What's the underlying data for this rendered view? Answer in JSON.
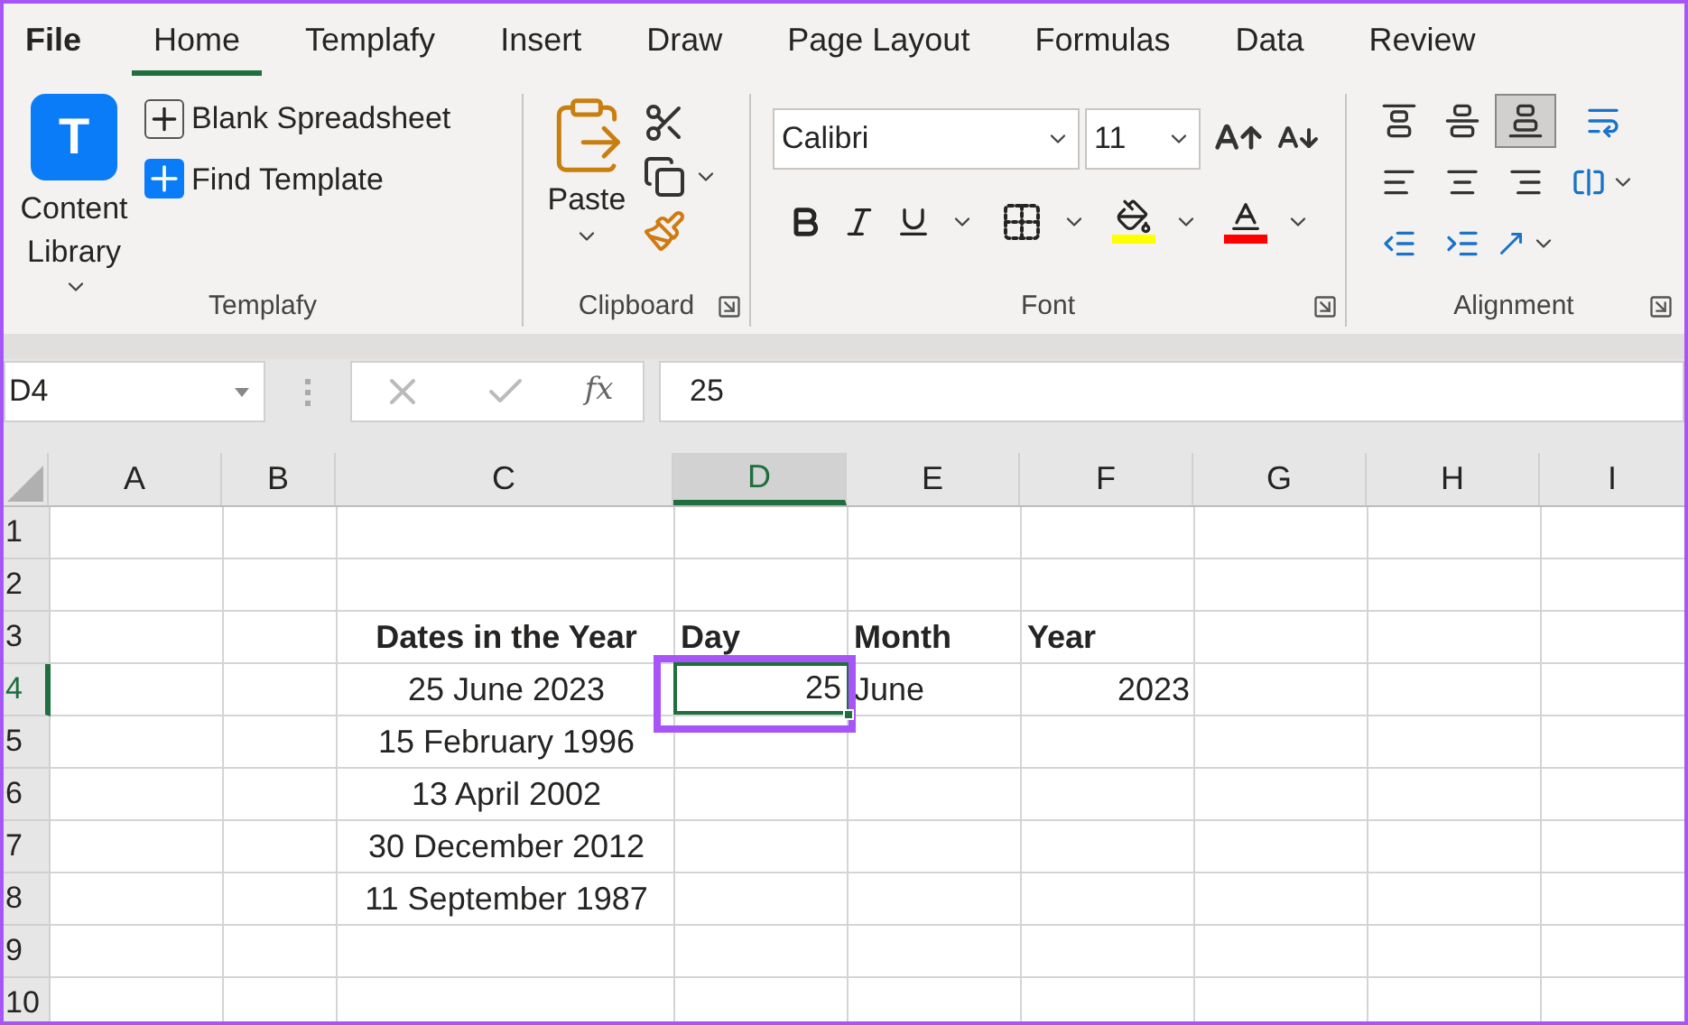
{
  "menu_tabs": [
    {
      "label": "File",
      "selected": false
    },
    {
      "label": "Home",
      "selected": true
    },
    {
      "label": "Templafy",
      "selected": false
    },
    {
      "label": "Insert",
      "selected": false
    },
    {
      "label": "Draw",
      "selected": false
    },
    {
      "label": "Page Layout",
      "selected": false
    },
    {
      "label": "Formulas",
      "selected": false
    },
    {
      "label": "Data",
      "selected": false
    },
    {
      "label": "Review",
      "selected": false
    }
  ],
  "templafy": {
    "logo_letter": "T",
    "content_library": "Content Library",
    "blank_spreadsheet": "Blank Spreadsheet",
    "find_template": "Find Template",
    "label": "Templafy"
  },
  "clipboard": {
    "paste": "Paste",
    "label": "Clipboard"
  },
  "font": {
    "name": "Calibri",
    "size": "11",
    "label": "Font"
  },
  "alignment": {
    "buttons": [
      {
        "kind": "top",
        "selected": false
      },
      {
        "kind": "middle",
        "selected": false
      },
      {
        "kind": "bottom",
        "selected": true
      },
      {
        "kind": "wrap",
        "selected": false
      },
      {
        "kind": "left",
        "selected": false
      },
      {
        "kind": "center",
        "selected": false
      },
      {
        "kind": "right",
        "selected": false
      },
      {
        "kind": "merge",
        "selected": false
      },
      {
        "kind": "outdent",
        "selected": false
      },
      {
        "kind": "indent",
        "selected": false
      },
      {
        "kind": "orientation",
        "selected": false
      }
    ],
    "label": "Alignment"
  },
  "formula_bar": {
    "name_box": "D4",
    "fx": "fx",
    "value": "25"
  },
  "columns": [
    {
      "label": "A",
      "selected": false
    },
    {
      "label": "B",
      "selected": false
    },
    {
      "label": "C",
      "selected": false
    },
    {
      "label": "D",
      "selected": true
    },
    {
      "label": "E",
      "selected": false
    },
    {
      "label": "F",
      "selected": false
    },
    {
      "label": "G",
      "selected": false
    },
    {
      "label": "H",
      "selected": false
    },
    {
      "label": "I",
      "selected": false
    }
  ],
  "rows": [
    {
      "label": "1",
      "selected": false,
      "cells": []
    },
    {
      "label": "2",
      "selected": false,
      "cells": []
    },
    {
      "label": "3",
      "selected": false,
      "cells": [
        null,
        null,
        {
          "text": "Dates in the Year",
          "kind": "title",
          "selected": false,
          "highlighted": false
        },
        {
          "text": "Day",
          "kind": "heading",
          "selected": false,
          "highlighted": false
        },
        {
          "text": "Month",
          "kind": "heading",
          "selected": false,
          "highlighted": false
        },
        {
          "text": "Year",
          "kind": "heading",
          "selected": false,
          "highlighted": false
        }
      ]
    },
    {
      "label": "4",
      "selected": true,
      "cells": [
        null,
        null,
        {
          "text": "25 June 2023",
          "kind": "date",
          "selected": false,
          "highlighted": false
        },
        {
          "text": "25",
          "kind": "number",
          "selected": true,
          "highlighted": true
        },
        {
          "text": "June",
          "kind": "text",
          "selected": false,
          "highlighted": false
        },
        {
          "text": "2023",
          "kind": "number",
          "selected": false,
          "highlighted": false
        }
      ]
    },
    {
      "label": "5",
      "selected": false,
      "cells": [
        null,
        null,
        {
          "text": "15 February 1996",
          "kind": "date",
          "selected": false,
          "highlighted": false
        }
      ]
    },
    {
      "label": "6",
      "selected": false,
      "cells": [
        null,
        null,
        {
          "text": "13 April 2002",
          "kind": "date",
          "selected": false,
          "highlighted": false
        }
      ]
    },
    {
      "label": "7",
      "selected": false,
      "cells": [
        null,
        null,
        {
          "text": "30 December 2012",
          "kind": "date",
          "selected": false,
          "highlighted": false
        }
      ]
    },
    {
      "label": "8",
      "selected": false,
      "cells": [
        null,
        null,
        {
          "text": "11 September 1987",
          "kind": "date",
          "selected": false,
          "highlighted": false
        }
      ]
    },
    {
      "label": "9",
      "selected": false,
      "cells": []
    },
    {
      "label": "10",
      "selected": false,
      "cells": []
    }
  ]
}
